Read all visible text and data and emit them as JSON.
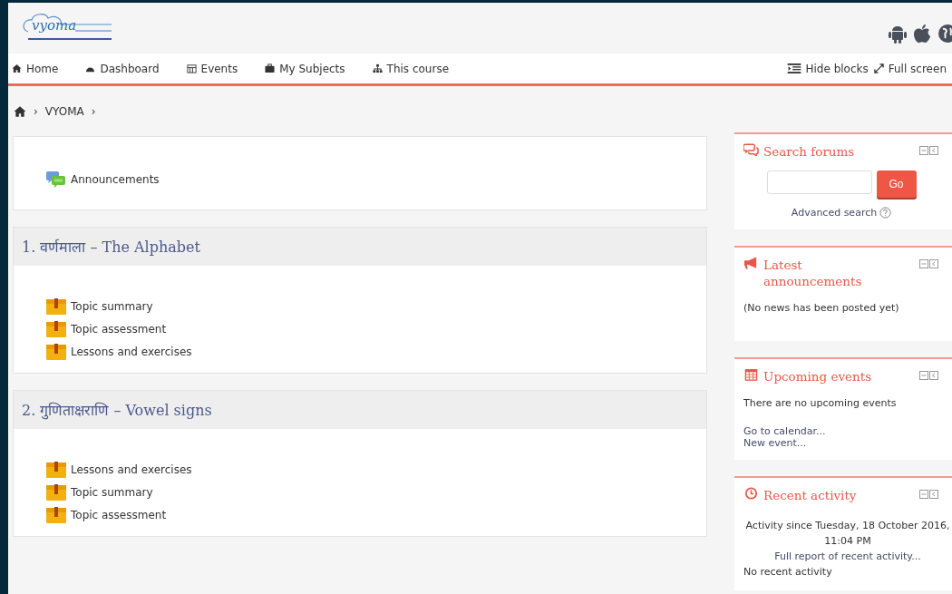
{
  "logo": {
    "text": "vyoma"
  },
  "nav": [
    {
      "label": "Home"
    },
    {
      "label": "Dashboard"
    },
    {
      "label": "Events"
    },
    {
      "label": "My Subjects"
    },
    {
      "label": "This course"
    }
  ],
  "nav_right": [
    {
      "label": "Hide blocks"
    },
    {
      "label": "Full screen"
    }
  ],
  "breadcrumb": {
    "items": [
      "VYOMA"
    ],
    "separator": "›"
  },
  "sections": [
    {
      "items": [
        {
          "kind": "forum",
          "label": "Announcements"
        }
      ]
    },
    {
      "title": "1. वर्णमाला – The Alphabet",
      "items": [
        {
          "kind": "book",
          "label": "Topic summary"
        },
        {
          "kind": "book",
          "label": "Topic assessment"
        },
        {
          "kind": "book",
          "label": "Lessons and exercises"
        }
      ]
    },
    {
      "title": "2. गुणिताक्षराणि – Vowel signs",
      "items": [
        {
          "kind": "book",
          "label": "Lessons and exercises"
        },
        {
          "kind": "book",
          "label": "Topic summary"
        },
        {
          "kind": "book",
          "label": "Topic assessment"
        }
      ]
    }
  ],
  "blocks": [
    {
      "kind": "search",
      "title": "Search forums",
      "button": "Go",
      "link": "Advanced search"
    },
    {
      "kind": "text",
      "title": "Latest announcements",
      "lines": [
        {
          "kind": "text",
          "text": "(No news has been posted yet)"
        }
      ]
    },
    {
      "kind": "text",
      "title": "Upcoming events",
      "lines": [
        {
          "kind": "text",
          "text": "There are no upcoming events"
        },
        {
          "kind": "link",
          "text": "Go to calendar..."
        },
        {
          "kind": "link",
          "text": "New event..."
        }
      ]
    },
    {
      "kind": "activity",
      "title": "Recent activity",
      "since": "Activity since Tuesday, 18 October 2016, 11:04 PM",
      "link": "Full report of recent activity...",
      "note": "No recent activity"
    }
  ]
}
